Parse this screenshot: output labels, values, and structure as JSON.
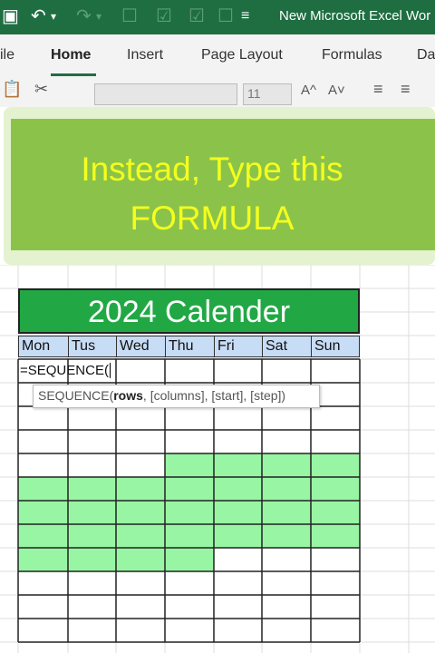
{
  "titlebar": {
    "title": "New Microsoft Excel Wor",
    "icons": [
      "save-icon",
      "undo-icon",
      "redo-icon",
      "checkbox-icon",
      "checkbox-checked-icon",
      "checkbox-checked-icon",
      "checkbox-icon",
      "format-icon"
    ]
  },
  "menu": {
    "items": [
      "ile",
      "Home",
      "Insert",
      "Page Layout",
      "Formulas",
      "Da"
    ],
    "active": "Home"
  },
  "ribbon": {
    "font_size": "11",
    "grow_label": "A^",
    "shrink_label": "A˅"
  },
  "overlay": {
    "line1": "Instead, Type this",
    "line2": "FORMULA"
  },
  "calendar": {
    "title": "2024 Calender",
    "days": [
      "Mon",
      "Tus",
      "Wed",
      "Thu",
      "Fri",
      "Sat",
      "Sun"
    ],
    "formula_text": "=SEQUENCE(",
    "tooltip": {
      "func": "SEQUENCE(",
      "bold_arg": "rows",
      "rest": ", [columns], [start], [step])"
    },
    "colors": {
      "title_bg": "#21a845",
      "day_header_bg": "#c7dcf5",
      "highlight": "#98f5a4"
    }
  }
}
